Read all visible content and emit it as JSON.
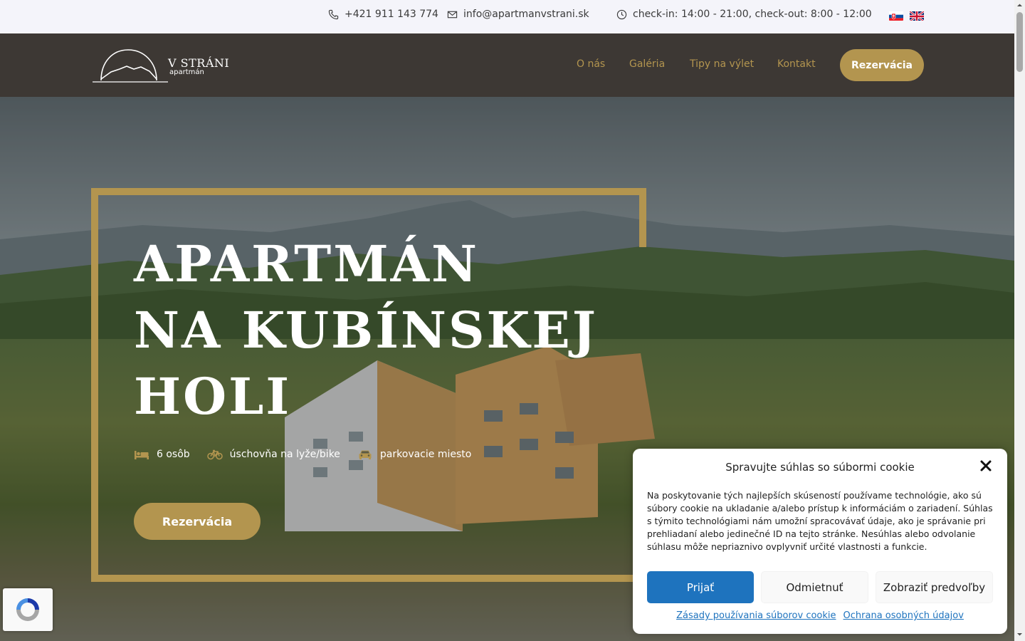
{
  "topbar": {
    "phone": "+421 911 143 774",
    "email": "info@apartmanvstrani.sk",
    "hours": "check-in: 14:00 - 21:00, check-out: 8:00 - 12:00",
    "languages": [
      "sk-flag-icon",
      "gb-flag-icon"
    ]
  },
  "header": {
    "logo_title": "V STRÁNI",
    "logo_sub": "apartmán",
    "nav": [
      "O nás",
      "Galéria",
      "Tipy na výlet",
      "Kontakt"
    ],
    "cta": "Rezervácia"
  },
  "hero": {
    "title_lines": [
      "APARTMÁN",
      "NA KUBÍNSKEJ",
      "HOLI"
    ],
    "features": [
      {
        "icon": "bed-icon",
        "label": "6 osôb"
      },
      {
        "icon": "bicycle-icon",
        "label": "úschovňa na lyže/bike"
      },
      {
        "icon": "car-icon",
        "label": "parkovacie miesto"
      }
    ],
    "cta": "Rezervácia"
  },
  "cookie": {
    "title": "Spravujte súhlas so súbormi cookie",
    "text": "Na poskytovanie tých najlepších skúseností používame technológie, ako sú súbory cookie na ukladanie a/alebo prístup k informáciám o zariadení. Súhlas s týmito technológiami nám umožní spracovávať údaje, ako je správanie pri prehliadaní alebo jedinečné ID na tejto stránke. Nesúhlas alebo odvolanie súhlasu môže nepriaznivo ovplyvniť určité vlastnosti a funkcie.",
    "accept": "Prijať",
    "deny": "Odmietnuť",
    "prefs": "Zobraziť predvoľby",
    "link_cookies": "Zásady používania súborov cookie",
    "link_privacy": "Ochrana osobných údajov"
  },
  "colors": {
    "accent": "#b3954f",
    "header_bg": "#3d3834",
    "topbar_bg": "#f4f4fa",
    "cookie_accept": "#1e73be"
  }
}
